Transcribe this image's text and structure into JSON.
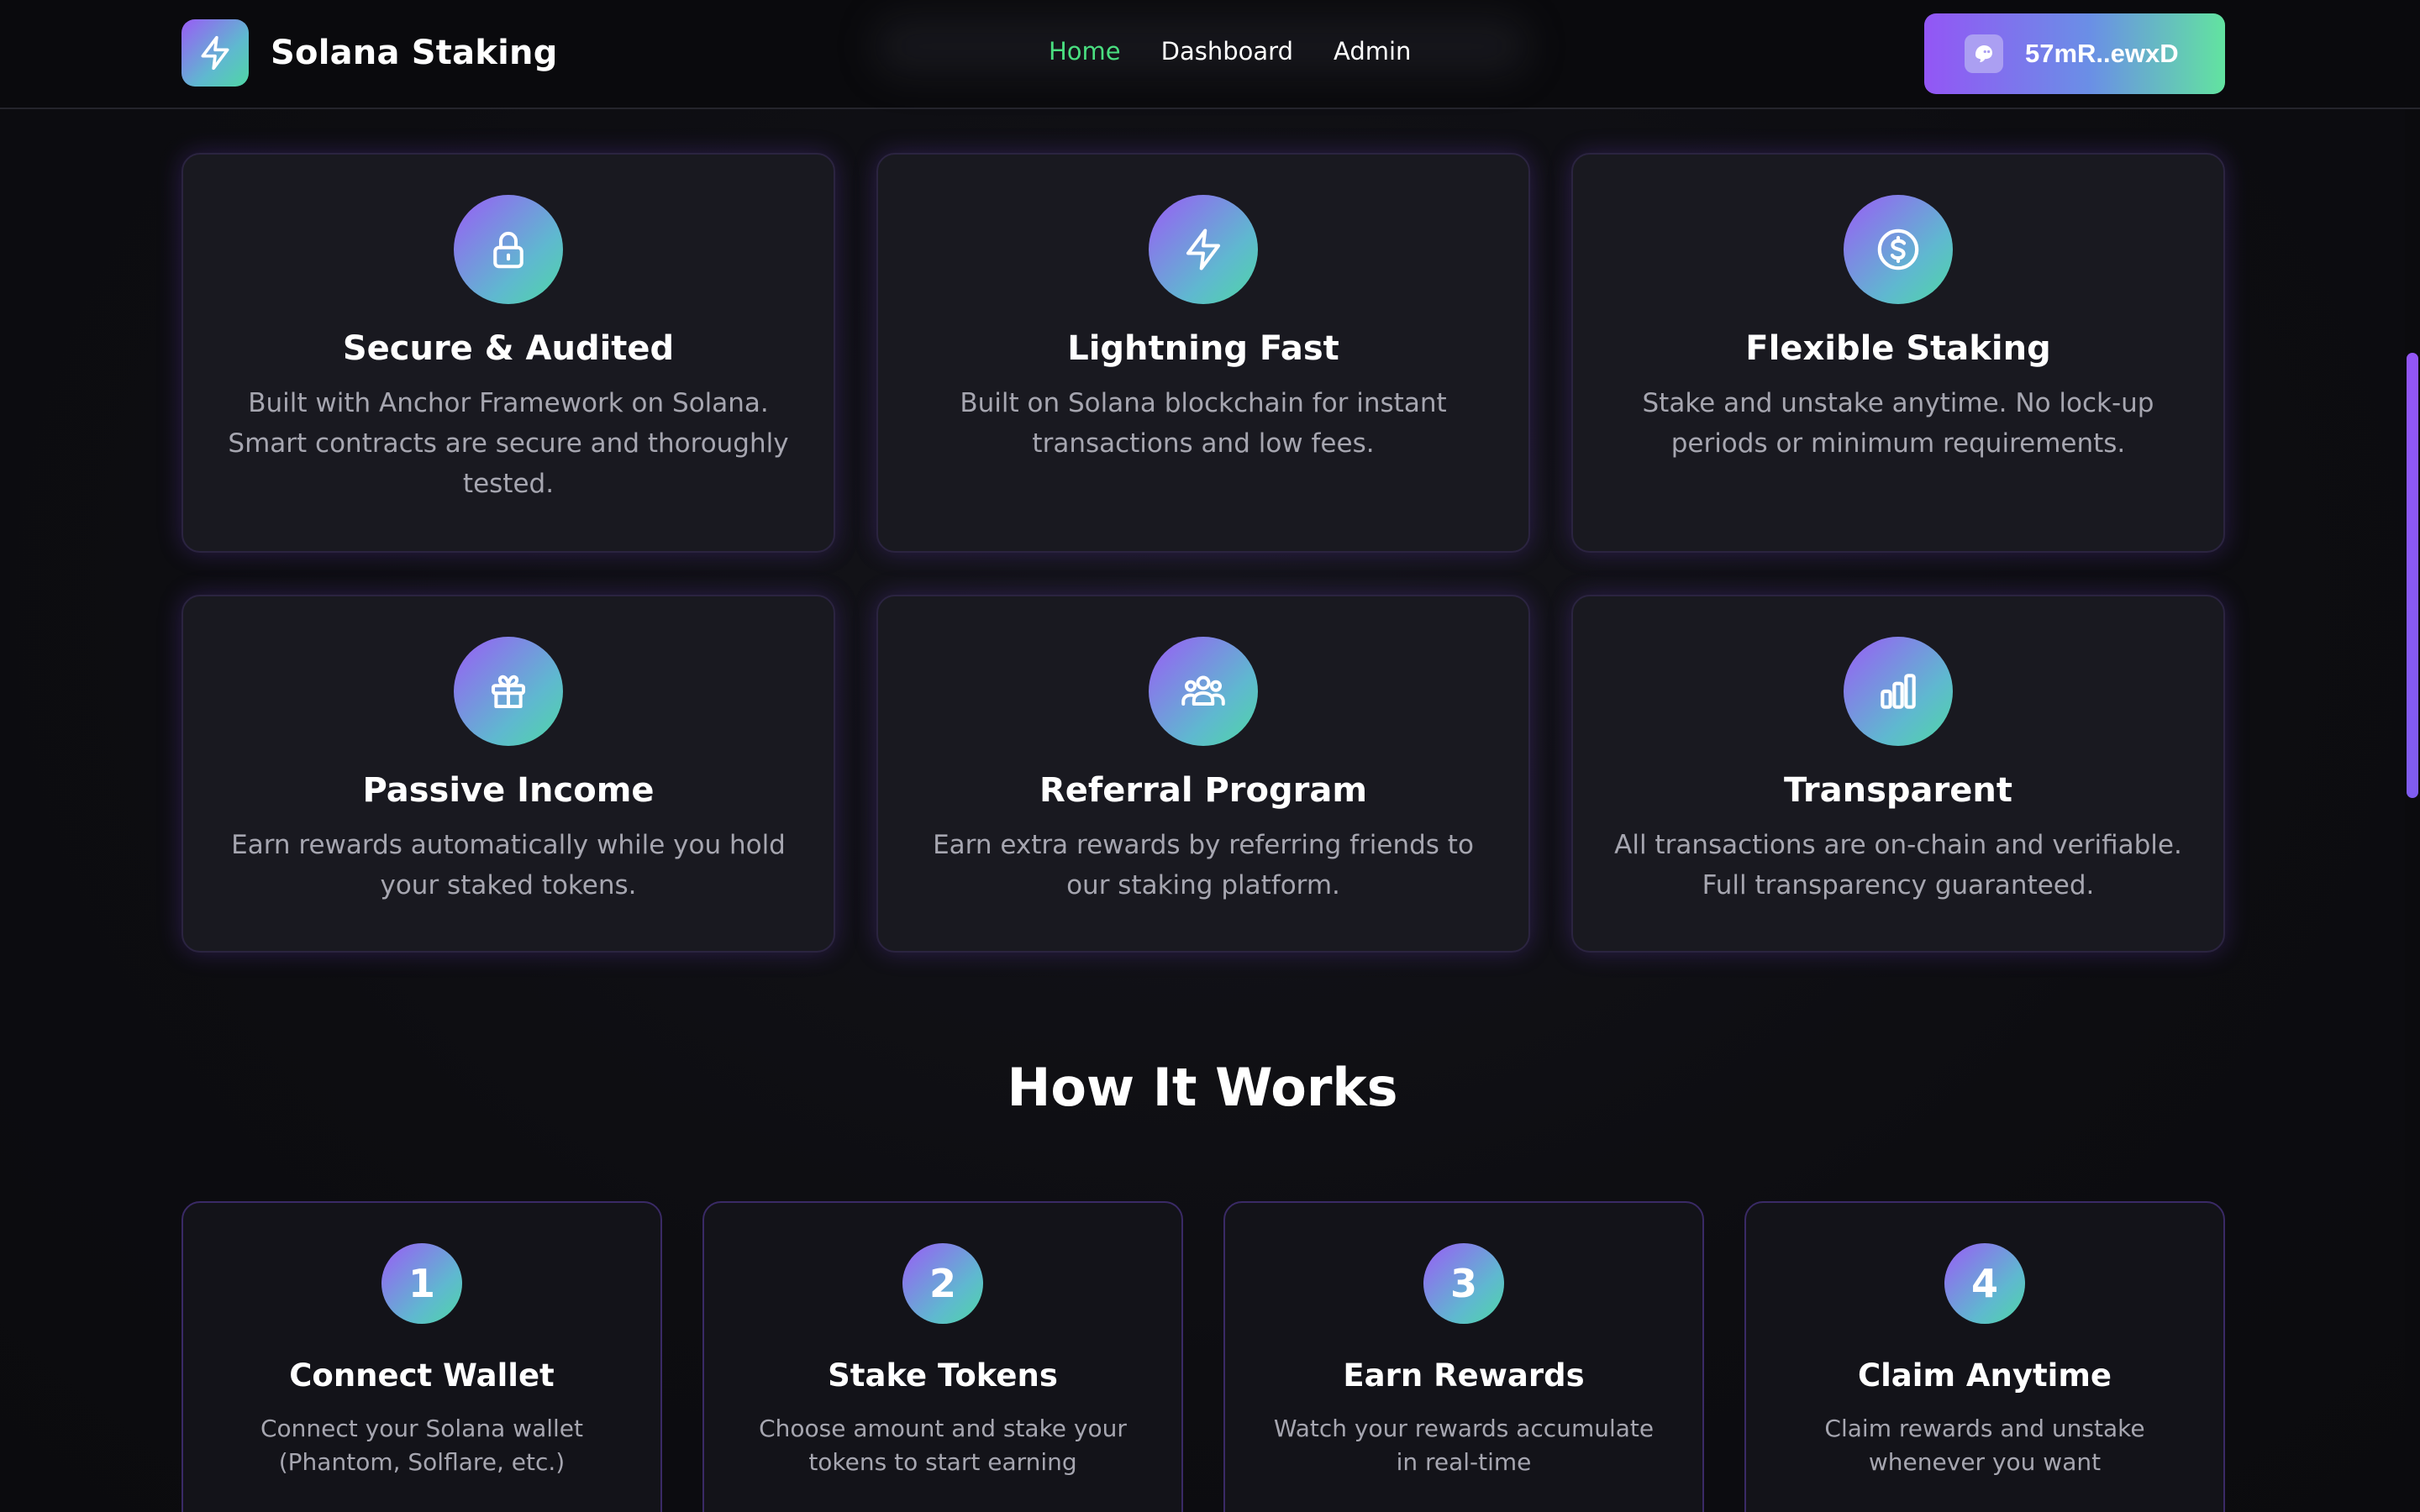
{
  "header": {
    "brand_name": "Solana Staking",
    "brand_icon": "lightning-icon",
    "nav": [
      {
        "label": "Home",
        "active": true
      },
      {
        "label": "Dashboard",
        "active": false
      },
      {
        "label": "Admin",
        "active": false
      }
    ],
    "wallet": {
      "address": "57mR..ewxD",
      "icon": "phantom-ghost-icon"
    }
  },
  "features": [
    {
      "icon": "lock-icon",
      "title": "Secure & Audited",
      "description": "Built with Anchor Framework on Solana. Smart contracts are secure and thoroughly tested."
    },
    {
      "icon": "lightning-icon",
      "title": "Lightning Fast",
      "description": "Built on Solana blockchain for instant transactions and low fees."
    },
    {
      "icon": "dollar-circle-icon",
      "title": "Flexible Staking",
      "description": "Stake and unstake anytime. No lock-up periods or minimum requirements."
    },
    {
      "icon": "gift-icon",
      "title": "Passive Income",
      "description": "Earn rewards automatically while you hold your staked tokens."
    },
    {
      "icon": "users-icon",
      "title": "Referral Program",
      "description": "Earn extra rewards by referring friends to our staking platform."
    },
    {
      "icon": "bar-chart-icon",
      "title": "Transparent",
      "description": "All transactions are on-chain and verifiable. Full transparency guaranteed."
    }
  ],
  "how_it_works": {
    "title": "How It Works",
    "steps": [
      {
        "number": "1",
        "title": "Connect Wallet",
        "description": "Connect your Solana wallet (Phantom, Solflare, etc.)"
      },
      {
        "number": "2",
        "title": "Stake Tokens",
        "description": "Choose amount and stake your tokens to start earning"
      },
      {
        "number": "3",
        "title": "Earn Rewards",
        "description": "Watch your rewards accumulate in real-time"
      },
      {
        "number": "4",
        "title": "Claim Anytime",
        "description": "Claim rewards and unstake whenever you want"
      }
    ]
  },
  "colors": {
    "accent_purple": "#9a5cf6",
    "accent_green": "#4fd7a4",
    "nav_active": "#4ade80",
    "background": "#0d0d11",
    "card_background": "#191920",
    "muted_text": "#a6a6b0"
  }
}
